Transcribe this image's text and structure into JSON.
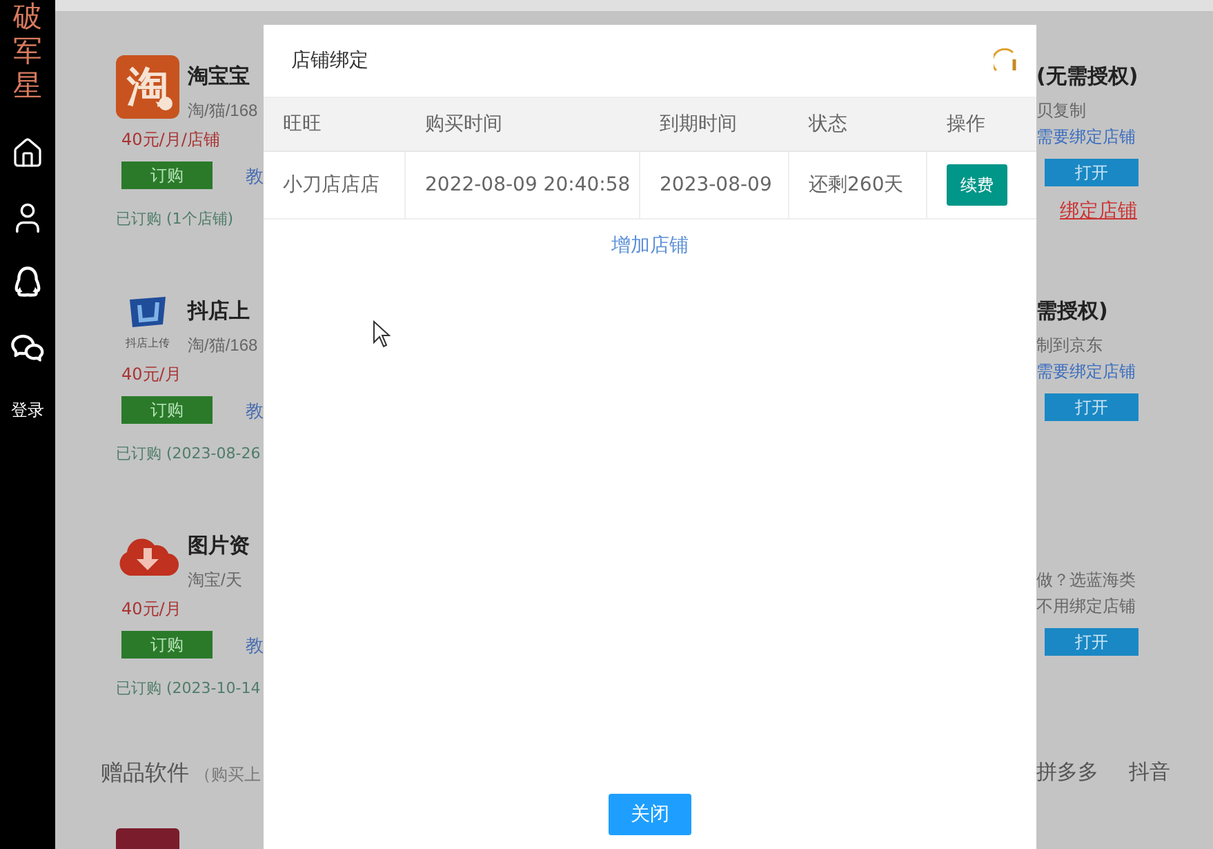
{
  "sidebar": {
    "logo": "破军星",
    "login": "登录"
  },
  "left_cards": [
    {
      "kind": "taobao",
      "icon_text": "淘",
      "title": "淘宝宝",
      "subtitle": "淘/猫/168",
      "price": "40元/月/店铺",
      "button": "订购",
      "link": "教",
      "status": "已订购 (1个店铺)"
    },
    {
      "kind": "doudian",
      "icon_text": "抖店上传",
      "title": "抖店上",
      "subtitle": "淘/猫/168",
      "price": "40元/月",
      "button": "订购",
      "link": "教",
      "status": "已订购 (2023-08-26"
    },
    {
      "kind": "cloud",
      "title": "图片资",
      "subtitle": "淘宝/天",
      "price": "40元/月",
      "button": "订购",
      "link": "教",
      "status": "已订购 (2023-10-14"
    }
  ],
  "right_cards": [
    {
      "title": "(无需授权)",
      "subtitle": "贝复制",
      "note": "需要绑定店铺",
      "kind": "link",
      "button": "打开",
      "bind_link": "绑定店铺"
    },
    {
      "title": "需授权)",
      "subtitle": "制到京东",
      "note": "需要绑定店铺",
      "kind": "link",
      "button": "打开"
    },
    {
      "subtitle": "做？选蓝海类",
      "note": "不用绑定店铺",
      "kind": "plain",
      "button": "打开"
    }
  ],
  "gift_section": {
    "title": "赠品软件",
    "note": "（购买上",
    "tabs": [
      "拼多多",
      "抖音"
    ]
  },
  "modal": {
    "title": "店铺绑定",
    "columns": [
      "旺旺",
      "购买时间",
      "到期时间",
      "状态",
      "操作"
    ],
    "rows": [
      {
        "cells": [
          "小刀店店店",
          "2022-08-09 20:40:58",
          "2023-08-09",
          "还剩260天"
        ],
        "action": "续费"
      }
    ],
    "add_link": "增加店铺",
    "close_button": "关闭"
  }
}
